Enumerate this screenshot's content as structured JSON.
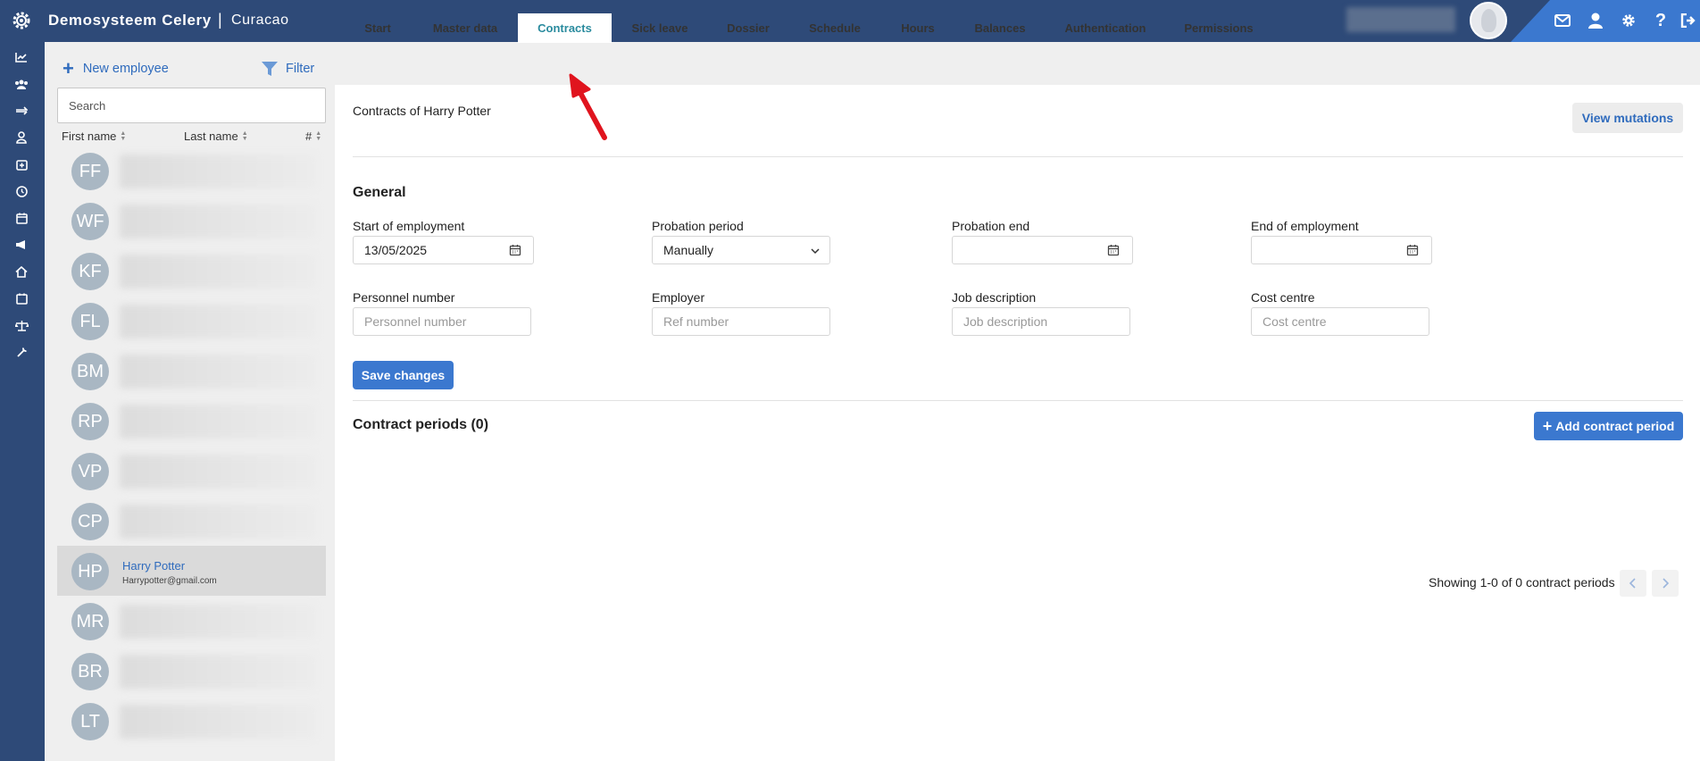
{
  "header": {
    "brand": "Demosysteem Celery",
    "separator": "|",
    "company": "Curacao"
  },
  "panel": {
    "new_employee_label": "New employee",
    "filter_label": "Filter",
    "search_placeholder": "Search",
    "columns": [
      "First name",
      "Last name",
      "#"
    ],
    "employees": [
      {
        "initials": "FF"
      },
      {
        "initials": "WF"
      },
      {
        "initials": "KF"
      },
      {
        "initials": "FL"
      },
      {
        "initials": "BM"
      },
      {
        "initials": "RP"
      },
      {
        "initials": "VP"
      },
      {
        "initials": "CP"
      },
      {
        "initials": "HP",
        "name": "Harry Potter",
        "email": "Harrypotter@gmail.com",
        "selected": true
      },
      {
        "initials": "MR"
      },
      {
        "initials": "BR"
      },
      {
        "initials": "LT"
      }
    ]
  },
  "tabs": [
    "Start",
    "Master data",
    "Contracts",
    "Sick leave",
    "Dossier",
    "Schedule",
    "Hours",
    "Balances",
    "Authentication",
    "Permissions"
  ],
  "active_tab": "Contracts",
  "main": {
    "title": "Contracts of Harry Potter",
    "view_mutations_label": "View mutations",
    "general_title": "General",
    "fields": {
      "start_label": "Start of employment",
      "start_value": "13/05/2025",
      "probation_label": "Probation period",
      "probation_value": "Manually",
      "probation_end_label": "Probation end",
      "end_label": "End of employment",
      "personnel_label": "Personnel number",
      "personnel_placeholder": "Personnel number",
      "employer_label": "Employer",
      "employer_placeholder": "Ref number",
      "job_label": "Job description",
      "job_placeholder": "Job description",
      "cost_label": "Cost centre",
      "cost_placeholder": "Cost centre"
    },
    "save_label": "Save changes",
    "periods_title": "Contract periods (0)",
    "add_period_label": "Add contract period",
    "pager_text": "Showing 1-0 of 0 contract periods"
  },
  "colors": {
    "navy": "#2e4a78",
    "accent_blue": "#3b78cf",
    "link_blue": "#2f6bbd",
    "active_tab": "#2a8b9e",
    "annotation_red": "#e0141e"
  },
  "icons": [
    "gear-logo-icon",
    "mail-icon",
    "user-icon",
    "settings-icon",
    "help-icon",
    "logout-icon",
    "calendar-icon",
    "chevron-down-icon",
    "filter-icon",
    "plus-icon",
    "chevron-left-icon",
    "chevron-right-icon"
  ]
}
